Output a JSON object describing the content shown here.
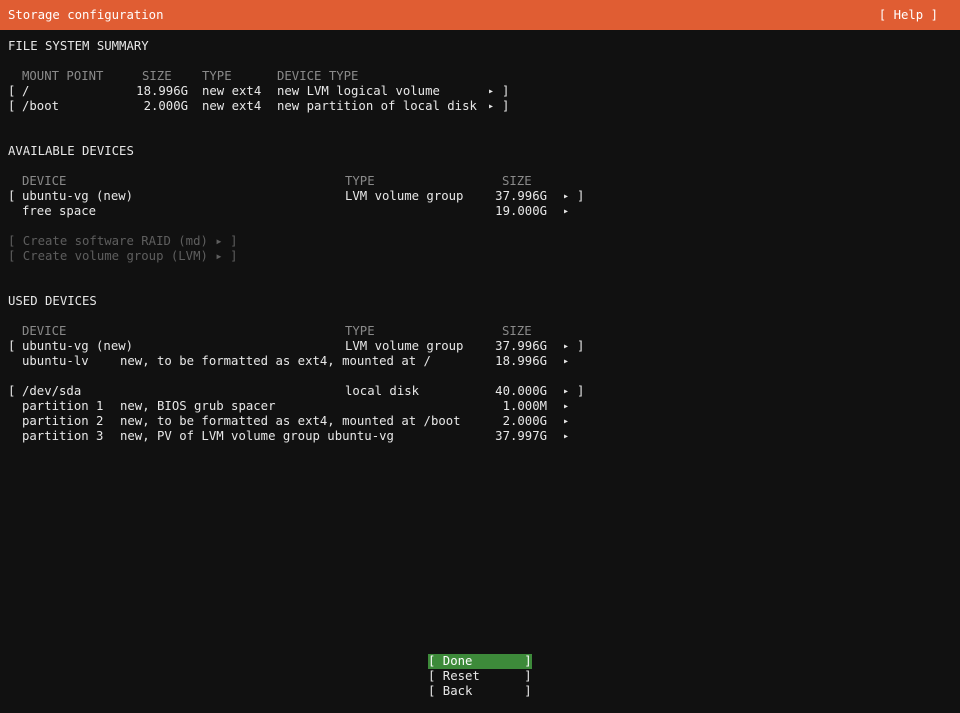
{
  "header": {
    "title": "Storage configuration",
    "help": "[ Help ]"
  },
  "fs_summary": {
    "title": "FILE SYSTEM SUMMARY",
    "columns": {
      "mount": "MOUNT POINT",
      "size": "SIZE",
      "type": "TYPE",
      "device_type": "DEVICE TYPE"
    },
    "rows": [
      {
        "mount": "/",
        "size": "18.996G",
        "type": "new ext4",
        "device_type": "new LVM logical volume"
      },
      {
        "mount": "/boot",
        "size": "2.000G",
        "type": "new ext4",
        "device_type": "new partition of local disk"
      }
    ]
  },
  "available": {
    "title": "AVAILABLE DEVICES",
    "columns": {
      "device": "DEVICE",
      "type": "TYPE",
      "size": "SIZE"
    },
    "vg": {
      "device": "ubuntu-vg (new)",
      "type": "LVM volume group",
      "size": "37.996G"
    },
    "free": {
      "device": "free space",
      "size": "19.000G"
    },
    "actions": [
      "[ Create software RAID (md) ▸ ]",
      "[ Create volume group (LVM) ▸ ]"
    ]
  },
  "used": {
    "title": "USED DEVICES",
    "columns": {
      "device": "DEVICE",
      "type": "TYPE",
      "size": "SIZE"
    },
    "vg": {
      "device": "ubuntu-vg (new)",
      "type": "LVM volume group",
      "size": "37.996G"
    },
    "lv": {
      "device": "ubuntu-lv",
      "desc": "new, to be formatted as ext4, mounted at /",
      "size": "18.996G"
    },
    "disk": {
      "device": "/dev/sda",
      "type": "local disk",
      "size": "40.000G"
    },
    "partitions": [
      {
        "name": "partition 1",
        "desc": "new, BIOS grub spacer",
        "size": "1.000M"
      },
      {
        "name": "partition 2",
        "desc": "new, to be formatted as ext4, mounted at /boot",
        "size": "2.000G"
      },
      {
        "name": "partition 3",
        "desc": "new, PV of LVM volume group ubuntu-vg",
        "size": "37.997G"
      }
    ]
  },
  "buttons": {
    "done": "[ Done       ]",
    "reset": "[ Reset      ]",
    "back": "[ Back       ]"
  },
  "glyphs": {
    "open": "[",
    "close": "]",
    "arrow": "▸"
  },
  "colors": {
    "header": "#e05d33",
    "focus": "#3d8a3a",
    "background": "#111111"
  }
}
